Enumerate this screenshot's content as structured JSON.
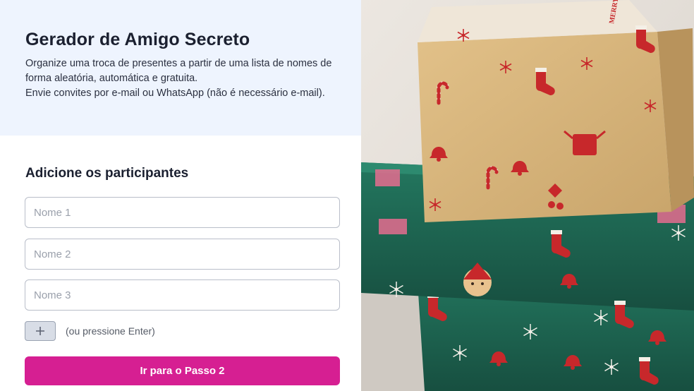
{
  "header": {
    "title": "Gerador de Amigo Secreto",
    "description_line1": "Organize uma troca de presentes a partir de uma lista de nomes de forma aleatória, automática e gratuita.",
    "description_line2": "Envie convites por e-mail ou WhatsApp (não é necessário e-mail)."
  },
  "participants": {
    "section_title": "Adicione os participantes",
    "fields": [
      {
        "placeholder": "Nome 1",
        "value": ""
      },
      {
        "placeholder": "Nome 2",
        "value": ""
      },
      {
        "placeholder": "Nome 3",
        "value": ""
      }
    ],
    "add_button_icon": "plus-icon",
    "add_hint": "(ou pressione Enter)"
  },
  "cta": {
    "label": "Ir para o Passo 2"
  },
  "illustration": {
    "subject": "christmas-gift-stack-photo",
    "wrap_text": "MERRY CHRISTMAS"
  },
  "colors": {
    "hero_background": "#eef4fe",
    "accent": "#d61f92",
    "kraft_wrap": "#d6b47d",
    "green_wrap": "#1f6a55",
    "red_pattern": "#c7282b"
  }
}
